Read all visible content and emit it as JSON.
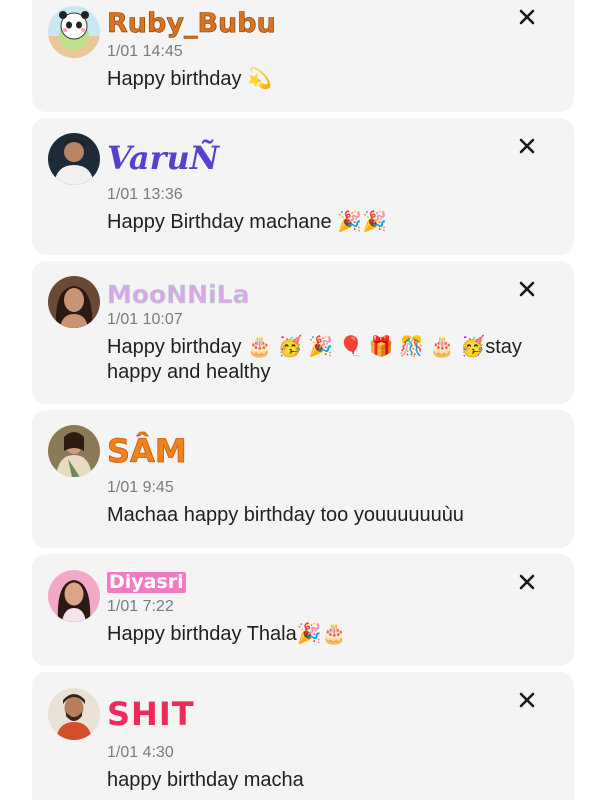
{
  "comments": [
    {
      "username": "Ruby_Bubu",
      "timestamp": "1/01 14:45",
      "message": "Happy birthday 💫",
      "name_color": "#d9731f",
      "avatar_icon": "panda-avatar"
    },
    {
      "username": "VaruÑ",
      "timestamp": "1/01 13:36",
      "message": "Happy Birthday machane 🎉🎉",
      "name_color": "#5a3fcf",
      "avatar_icon": "man-avatar"
    },
    {
      "username": "MooNNiLa",
      "timestamp": "1/01 10:07",
      "message": "Happy birthday 🎂 🥳 🎉 🎈 🎁 🎊 🎂 🥳stay happy and healthy",
      "name_color": "#d9a6e8",
      "avatar_icon": "woman-avatar"
    },
    {
      "username": "SÂM",
      "timestamp": "1/01 9:45",
      "message": "Machaa happy birthday too youuuuuuùu",
      "name_color": "#f0821e",
      "avatar_icon": "woman-saree-avatar"
    },
    {
      "username": "Diyasri",
      "timestamp": "1/01 7:22",
      "message": "Happy birthday Thala🎉🎂",
      "name_color": "#ffffff",
      "avatar_icon": "girl-avatar"
    },
    {
      "username": "SHIT",
      "timestamp": "1/01 4:30",
      "message": "happy birthday macha",
      "name_color": "#ee2a5a",
      "avatar_icon": "man-beard-avatar"
    }
  ],
  "close_icon": "close-icon"
}
